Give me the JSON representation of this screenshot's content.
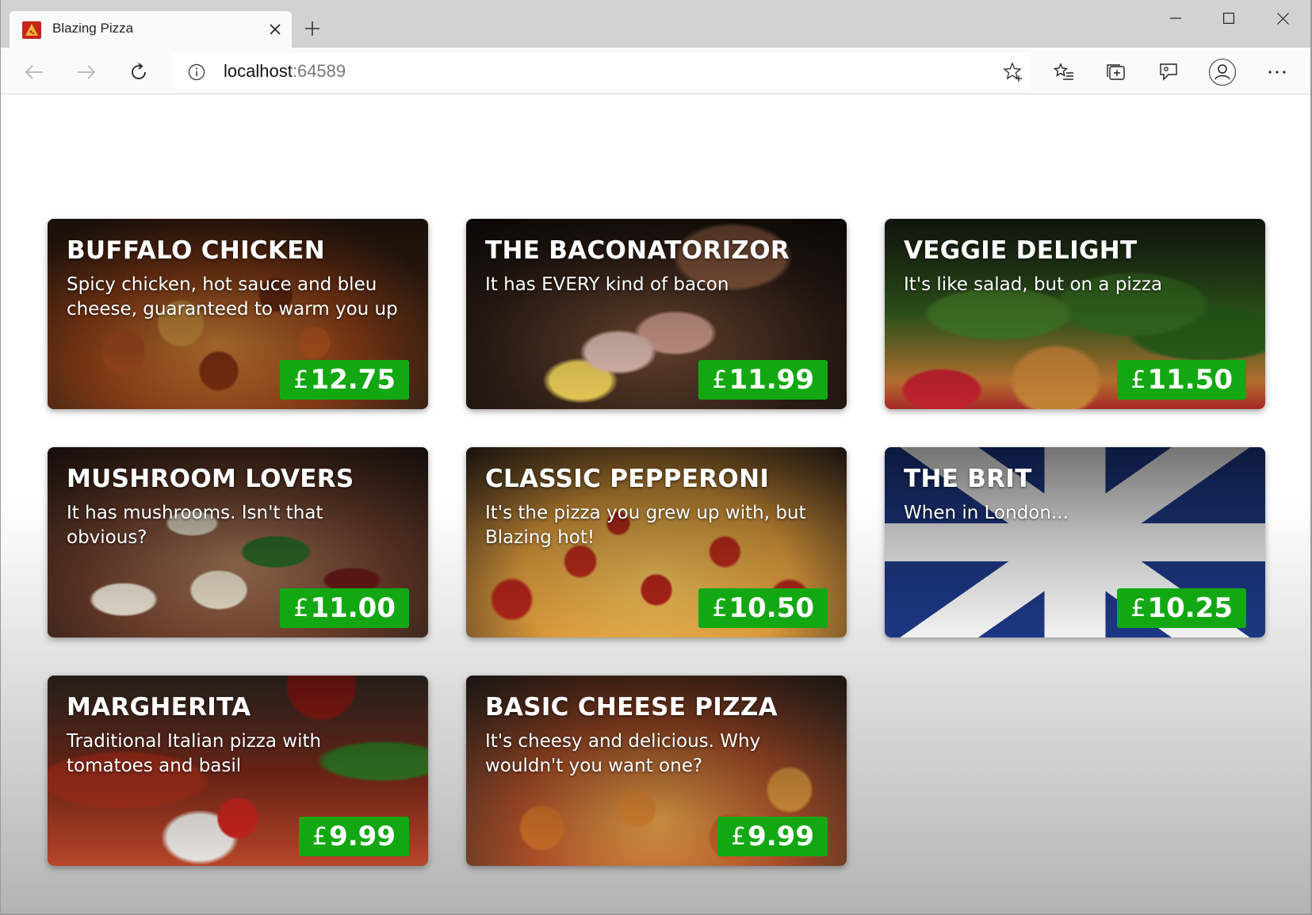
{
  "browser": {
    "tab_title": "Blazing Pizza",
    "address_host": "localhost",
    "address_port": ":64589"
  },
  "currency_symbol": "£",
  "pizzas": [
    {
      "name": "BUFFALO CHICKEN",
      "description": "Spicy chicken, hot sauce and bleu cheese, guaranteed to warm you up",
      "price": "12.75"
    },
    {
      "name": "THE BACONATORIZOR",
      "description": "It has EVERY kind of bacon",
      "price": "11.99"
    },
    {
      "name": "VEGGIE DELIGHT",
      "description": "It's like salad, but on a pizza",
      "price": "11.50"
    },
    {
      "name": "MUSHROOM LOVERS",
      "description": "It has mushrooms. Isn't that obvious?",
      "price": "11.00"
    },
    {
      "name": "CLASSIC PEPPERONI",
      "description": "It's the pizza you grew up with, but Blazing hot!",
      "price": "10.50"
    },
    {
      "name": "THE BRIT",
      "description": "When in London...",
      "price": "10.25"
    },
    {
      "name": "MARGHERITA",
      "description": "Traditional Italian pizza with tomatoes and basil",
      "price": "9.99"
    },
    {
      "name": "BASIC CHEESE PIZZA",
      "description": "It's cheesy and delicious. Why wouldn't you want one?",
      "price": "9.99"
    }
  ],
  "colors": {
    "price_badge": "#13a813",
    "favicon": "#c4261c"
  }
}
